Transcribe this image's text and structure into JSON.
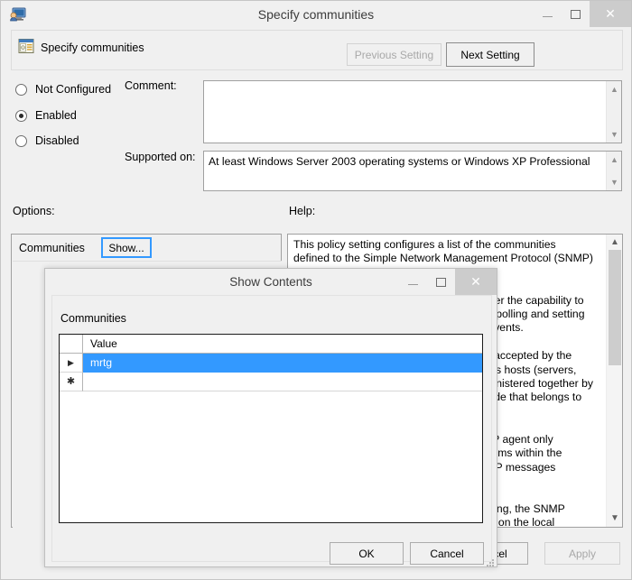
{
  "window": {
    "title": "Specify communities",
    "icon": "policy-computer-icon",
    "controls": {
      "minimize": "–",
      "maximize": "□",
      "close": "✕"
    }
  },
  "header": {
    "icon": "policy-setting-icon",
    "label": "Specify communities",
    "previous_setting": "Previous Setting",
    "next_setting": "Next Setting"
  },
  "state": {
    "options": [
      {
        "label": "Not Configured",
        "selected": false
      },
      {
        "label": "Enabled",
        "selected": true
      },
      {
        "label": "Disabled",
        "selected": false
      }
    ]
  },
  "fields": {
    "comment_label": "Comment:",
    "comment_value": "",
    "supported_label": "Supported on:",
    "supported_value": "At least Windows Server 2003 operating systems or Windows XP Professional"
  },
  "sections": {
    "options_label": "Options:",
    "help_label": "Help:"
  },
  "options_panel": {
    "communities_label": "Communities",
    "show_button": "Show..."
  },
  "help": {
    "text": "This policy setting configures a list of the communities defined to the Simple Network Management Protocol (SNMP) service.\n\nSNMP is a protocol designed to give a user the capability to remotely manage a computer network by polling and setting terminal values and monitoring network events.\n\nA valid community is a community that is accepted by the SNMP agent. A community name identifies hosts (servers, workstations, hubs, routers) that are administered together by network managers, and it is a network node that belongs to that community.\n\nIf you enable this policy setting, the SNMP agent only accepts requests from management systems within the communities it recognizes, and only SNMP messages allowed for the community are accepted.\n\nIf you disable or do not configure this setting, the SNMP service takes the communities configured on the local computer."
  },
  "main_buttons": {
    "ok": "OK",
    "cancel": "Cancel",
    "apply": "Apply"
  },
  "modal": {
    "title": "Show Contents",
    "controls": {
      "minimize": "–",
      "maximize": "□",
      "close": "✕"
    },
    "field_label": "Communities",
    "grid": {
      "columns": [
        "",
        "Value"
      ],
      "rows": [
        {
          "indicator": "▶",
          "value": "mrtg",
          "selected": true
        },
        {
          "indicator": "✱",
          "value": "",
          "selected": false
        }
      ]
    },
    "ok": "OK",
    "cancel": "Cancel"
  },
  "colors": {
    "selection_blue": "#3399ff",
    "focus_blue": "#3399ff",
    "window_bg": "#f0f0f0"
  }
}
